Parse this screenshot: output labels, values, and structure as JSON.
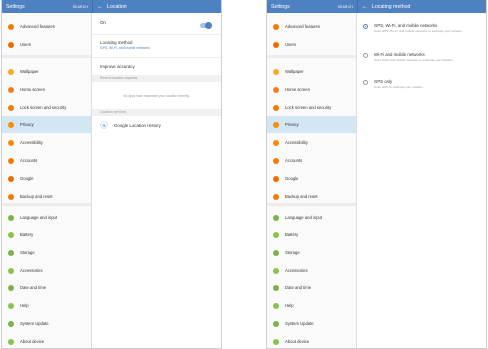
{
  "left_panel": {
    "header": {
      "title": "Settings",
      "search": "SEARCH"
    },
    "detail_title": "Location",
    "toggle_label": "On",
    "locating_method": {
      "label": "Locating method",
      "value": "GPS, Wi-Fi, and mobile networks"
    },
    "improve_accuracy": "Improve accuracy",
    "recent_requests_header": "Recent location requests",
    "recent_requests_empty": "No apps have requested your location recently.",
    "location_services_header": "Location services",
    "google_history": "Google Location History",
    "google_icon_letter": "G"
  },
  "right_panel": {
    "header": {
      "title": "Settings",
      "search": "SEARCH"
    },
    "detail_title": "Locating method",
    "options": [
      {
        "title": "GPS, Wi-Fi, and mobile networks",
        "desc": "Uses GPS, Wi-Fi, and mobile networks to estimate your location.",
        "selected": true
      },
      {
        "title": "Wi-Fi and mobile networks",
        "desc": "Uses Wi-Fi and mobile networks to estimate your location.",
        "selected": false
      },
      {
        "title": "GPS only",
        "desc": "Uses GPS to estimate your location.",
        "selected": false
      }
    ]
  },
  "sidebar": {
    "items": [
      {
        "label": "Advanced features",
        "icon": "advanced-features-icon",
        "color": "#f57c00"
      },
      {
        "label": "Users",
        "icon": "users-icon",
        "color": "#ef6c00"
      },
      {
        "label": "Wallpaper",
        "icon": "wallpaper-icon",
        "color": "#f9a825"
      },
      {
        "label": "Home screen",
        "icon": "home-screen-icon",
        "color": "#f57f17"
      },
      {
        "label": "Lock screen and security",
        "icon": "lock-icon",
        "color": "#f57c00"
      },
      {
        "label": "Privacy",
        "icon": "privacy-icon",
        "color": "#fb8c00"
      },
      {
        "label": "Accessibility",
        "icon": "accessibility-icon",
        "color": "#fb8c00"
      },
      {
        "label": "Accounts",
        "icon": "accounts-icon",
        "color": "#f57c00"
      },
      {
        "label": "Google",
        "icon": "google-icon",
        "color": "#ef6c00"
      },
      {
        "label": "Backup and reset",
        "icon": "backup-icon",
        "color": "#f57c00"
      },
      {
        "label": "Language and input",
        "icon": "language-icon",
        "color": "#7cb342"
      },
      {
        "label": "Battery",
        "icon": "battery-icon",
        "color": "#8bc34a"
      },
      {
        "label": "Storage",
        "icon": "storage-icon",
        "color": "#7cb342"
      },
      {
        "label": "Accessories",
        "icon": "accessories-icon",
        "color": "#8bc34a"
      },
      {
        "label": "Date and time",
        "icon": "clock-icon",
        "color": "#7cb342"
      },
      {
        "label": "Help",
        "icon": "help-icon",
        "color": "#8bc34a"
      },
      {
        "label": "System Update",
        "icon": "system-update-icon",
        "color": "#7cb342"
      },
      {
        "label": "About device",
        "icon": "about-icon",
        "color": "#8bc34a"
      }
    ],
    "selected_index": 5
  },
  "colors": {
    "header": "#4e81c1",
    "selected": "#d3e6f4",
    "accent": "#4e81c1"
  }
}
